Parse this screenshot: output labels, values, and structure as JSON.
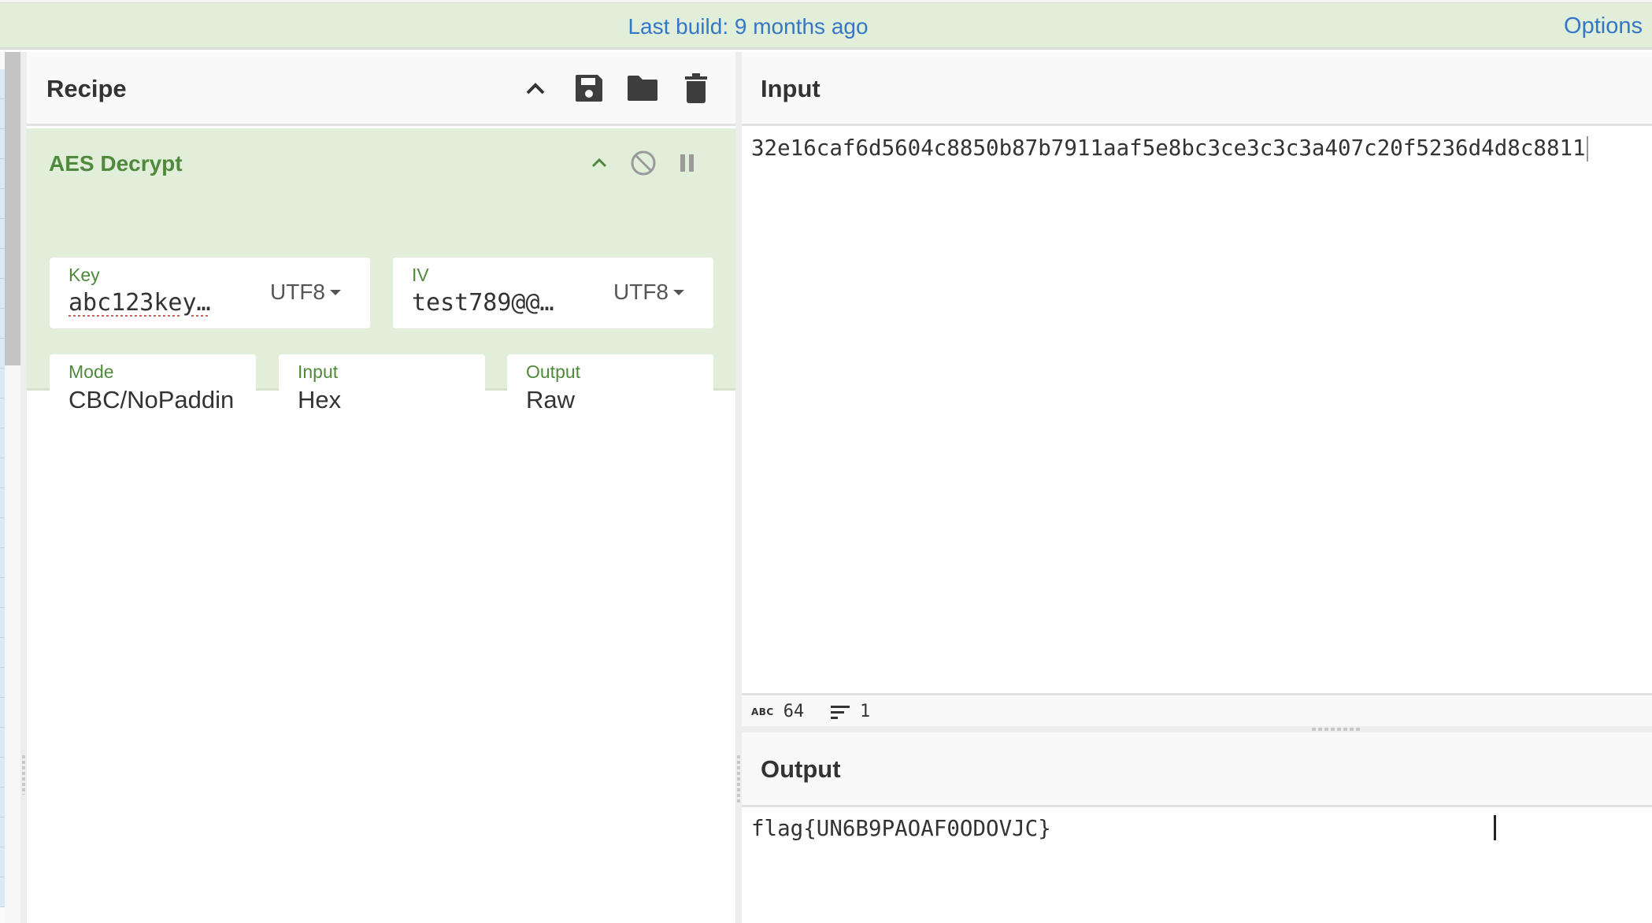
{
  "banner": {
    "last_build": "Last build: 9 months ago",
    "options_label": "Options"
  },
  "recipe": {
    "title": "Recipe",
    "icons": {
      "collapse": "chevron-up-icon",
      "save": "save-icon",
      "load": "folder-icon",
      "clear": "trash-icon"
    },
    "operations": [
      {
        "name": "AES Decrypt",
        "key": {
          "label": "Key",
          "value": "abc123key…",
          "encoding": "UTF8"
        },
        "iv": {
          "label": "IV",
          "value": "test789@@…",
          "encoding": "UTF8"
        },
        "mode": {
          "label": "Mode",
          "value": "CBC/NoPaddin"
        },
        "input": {
          "label": "Input",
          "value": "Hex"
        },
        "output": {
          "label": "Output",
          "value": "Raw"
        }
      }
    ]
  },
  "input": {
    "title": "Input",
    "text": "32e16caf6d5604c8850b87b7911aaf5e8bc3ce3c3c3a407c20f5236d4d8c8811",
    "stats": {
      "length": "64",
      "lines": "1"
    }
  },
  "output": {
    "title": "Output",
    "text": "flag{UN6B9PAOAF0ODOVJC}"
  },
  "colors": {
    "banner_bg": "#e1eeda",
    "link": "#3577c7",
    "op_bg": "#e1eeda",
    "op_title": "#4f8a3c"
  }
}
